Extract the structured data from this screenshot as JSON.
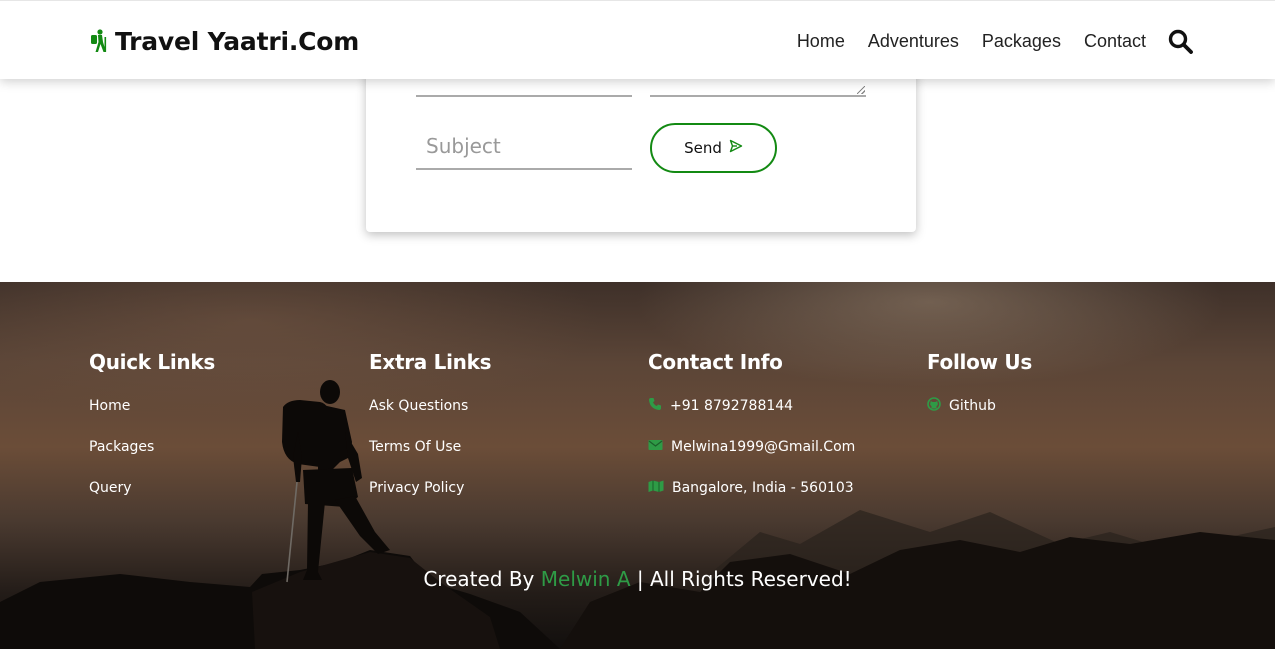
{
  "header": {
    "logo_text": "Travel Yaatri.Com",
    "logo_icon": "hiker-icon",
    "nav": [
      {
        "label": "Home"
      },
      {
        "label": "Adventures"
      },
      {
        "label": "Packages"
      },
      {
        "label": "Contact"
      }
    ],
    "search_icon": "search-icon"
  },
  "contact_form": {
    "subject_placeholder": "Subject",
    "subject_value": "",
    "send_label": "Send",
    "send_icon": "paper-plane-icon"
  },
  "footer": {
    "quick_links": {
      "title": "Quick Links",
      "items": [
        "Home",
        "Packages",
        "Query"
      ]
    },
    "extra_links": {
      "title": "Extra Links",
      "items": [
        "Ask Questions",
        "Terms Of Use",
        "Privacy Policy"
      ]
    },
    "contact_info": {
      "title": "Contact Info",
      "phone": "+91 8792788144",
      "email": "Melwina1999@Gmail.Com",
      "address": "Bangalore, India - 560103"
    },
    "follow_us": {
      "title": "Follow Us",
      "github": "Github"
    },
    "credit": {
      "prefix": "Created By",
      "name": "Melwin A",
      "suffix": "| All Rights Reserved!"
    }
  },
  "colors": {
    "accent": "#138a13",
    "footer_icon_green": "#2e9b46"
  }
}
